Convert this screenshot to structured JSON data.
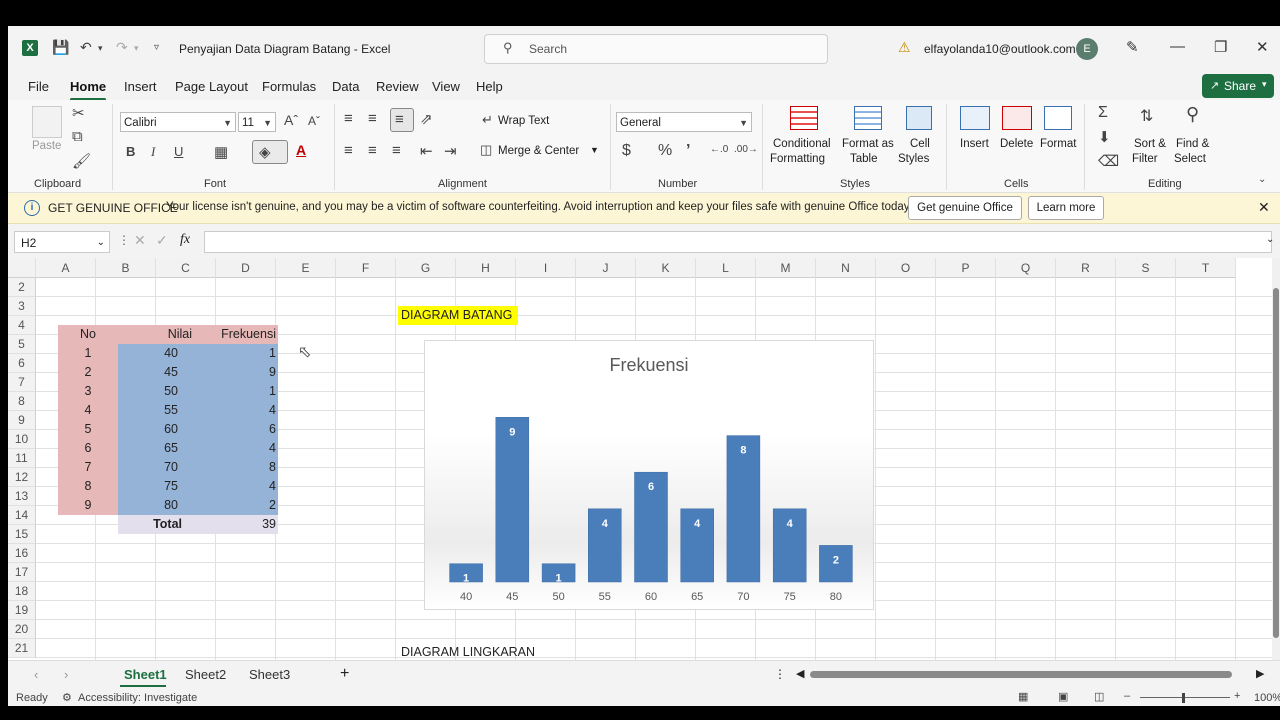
{
  "titlebar": {
    "doc_title": "Penyajian Data Diagram Batang  -  Excel",
    "search_placeholder": "Search",
    "email": "elfayolanda10@outlook.com",
    "avatar_initial": "E"
  },
  "menu": [
    "File",
    "Home",
    "Insert",
    "Page Layout",
    "Formulas",
    "Data",
    "Review",
    "View",
    "Help"
  ],
  "share_label": "Share",
  "ribbon": {
    "clipboard": {
      "paste": "Paste",
      "label": "Clipboard"
    },
    "font": {
      "name": "Calibri",
      "size": "11",
      "label": "Font",
      "bold": "B",
      "italic": "I",
      "underline": "U"
    },
    "alignment": {
      "wrap": "Wrap Text",
      "merge": "Merge & Center",
      "label": "Alignment"
    },
    "number": {
      "format": "General",
      "label": "Number"
    },
    "styles": {
      "conditional_1": "Conditional",
      "conditional_2": "Formatting",
      "table_1": "Format as",
      "table_2": "Table",
      "cell_1": "Cell",
      "cell_2": "Styles",
      "label": "Styles"
    },
    "cells": {
      "insert": "Insert",
      "delete": "Delete",
      "format": "Format",
      "label": "Cells"
    },
    "editing": {
      "sort_1": "Sort &",
      "sort_2": "Filter",
      "find_1": "Find &",
      "find_2": "Select",
      "label": "Editing"
    }
  },
  "license": {
    "title": "GET GENUINE OFFICE",
    "message": "Your license isn't genuine, and you may be a victim of software counterfeiting. Avoid interruption and keep your files safe with genuine Office today.",
    "btn_genuine": "Get genuine Office",
    "btn_learn": "Learn more"
  },
  "formula_bar": {
    "namebox": "H2",
    "fx": "fx"
  },
  "columns": [
    "A",
    "B",
    "C",
    "D",
    "E",
    "F",
    "G",
    "H",
    "I",
    "J",
    "K",
    "L",
    "M",
    "N",
    "O",
    "P",
    "Q",
    "R",
    "S",
    "T"
  ],
  "rows": [
    "2",
    "3",
    "4",
    "5",
    "6",
    "7",
    "8",
    "9",
    "10",
    "11",
    "12",
    "13",
    "14",
    "15",
    "16",
    "17",
    "18",
    "19",
    "20",
    "21"
  ],
  "sheet": {
    "title_bar_chart": "DIAGRAM BATANG",
    "title_pie_chart": "DIAGRAM LINGKARAN",
    "headers": {
      "no": "No",
      "nilai": "Nilai",
      "frekuensi": "Frekuensi"
    },
    "table": [
      {
        "no": "1",
        "nilai": "40",
        "frek": "1"
      },
      {
        "no": "2",
        "nilai": "45",
        "frek": "9"
      },
      {
        "no": "3",
        "nilai": "50",
        "frek": "1"
      },
      {
        "no": "4",
        "nilai": "55",
        "frek": "4"
      },
      {
        "no": "5",
        "nilai": "60",
        "frek": "6"
      },
      {
        "no": "6",
        "nilai": "65",
        "frek": "4"
      },
      {
        "no": "7",
        "nilai": "70",
        "frek": "8"
      },
      {
        "no": "8",
        "nilai": "75",
        "frek": "4"
      },
      {
        "no": "9",
        "nilai": "80",
        "frek": "2"
      }
    ],
    "total_label": "Total",
    "total_value": "39"
  },
  "chart_data": {
    "type": "bar",
    "title": "Frekuensi",
    "categories": [
      "40",
      "45",
      "50",
      "55",
      "60",
      "65",
      "70",
      "75",
      "80"
    ],
    "values": [
      1,
      9,
      1,
      4,
      6,
      4,
      8,
      4,
      2
    ],
    "xlabel": "",
    "ylabel": "",
    "ylim": [
      0,
      10
    ],
    "grid": false,
    "data_labels": true,
    "colors": {
      "bar": "#4a7ebb"
    }
  },
  "tabs": [
    "Sheet1",
    "Sheet2",
    "Sheet3"
  ],
  "status": {
    "ready": "Ready",
    "accessibility": "Accessibility: Investigate",
    "zoom": "100%"
  }
}
